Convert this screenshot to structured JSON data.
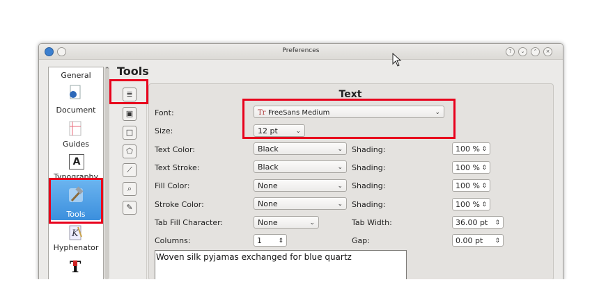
{
  "window": {
    "title": "Preferences",
    "titlebar_buttons": [
      "help-icon",
      "minimize-icon",
      "maximize-icon",
      "close-icon"
    ]
  },
  "sidebar": {
    "items": [
      {
        "label": "General",
        "icon": "general-icon"
      },
      {
        "label": "Document",
        "icon": "document-icon"
      },
      {
        "label": "Guides",
        "icon": "guides-icon"
      },
      {
        "label": "Typography",
        "icon": "typography-icon"
      },
      {
        "label": "Tools",
        "icon": "hammer-icon",
        "selected": true
      },
      {
        "label": "Hyphenator",
        "icon": "hyphenator-icon"
      }
    ]
  },
  "page": {
    "heading": "Tools",
    "panel_title": "Text"
  },
  "tool_buttons": [
    "text-frame-icon",
    "image-frame-icon",
    "shape-icon",
    "polygon-icon",
    "line-icon",
    "zoom-icon",
    "eyedropper-icon"
  ],
  "form": {
    "font_label": "Font:",
    "font_value": "FreeSans Medium",
    "font_prefix": "Tr",
    "size_label": "Size:",
    "size_value": "12 pt",
    "text_color_label": "Text Color:",
    "text_color_value": "Black",
    "text_color_shading_label": "Shading:",
    "text_color_shading": "100 %",
    "text_stroke_label": "Text Stroke:",
    "text_stroke_value": "Black",
    "text_stroke_shading_label": "Shading:",
    "text_stroke_shading": "100 %",
    "fill_color_label": "Fill Color:",
    "fill_color_value": "None",
    "fill_color_shading_label": "Shading:",
    "fill_color_shading": "100 %",
    "stroke_color_label": "Stroke Color:",
    "stroke_color_value": "None",
    "stroke_color_shading_label": "Shading:",
    "stroke_color_shading": "100 %",
    "tab_fill_label": "Tab Fill Character:",
    "tab_fill_value": "None",
    "tab_width_label": "Tab Width:",
    "tab_width_value": "36.00 pt",
    "columns_label": "Columns:",
    "columns_value": "1",
    "gap_label": "Gap:",
    "gap_value": "0.00 pt",
    "sample_text": "Woven silk pyjamas exchanged for blue quartz"
  },
  "colors": {
    "highlight": "#e8001c",
    "selection": "#3b8fdd"
  }
}
